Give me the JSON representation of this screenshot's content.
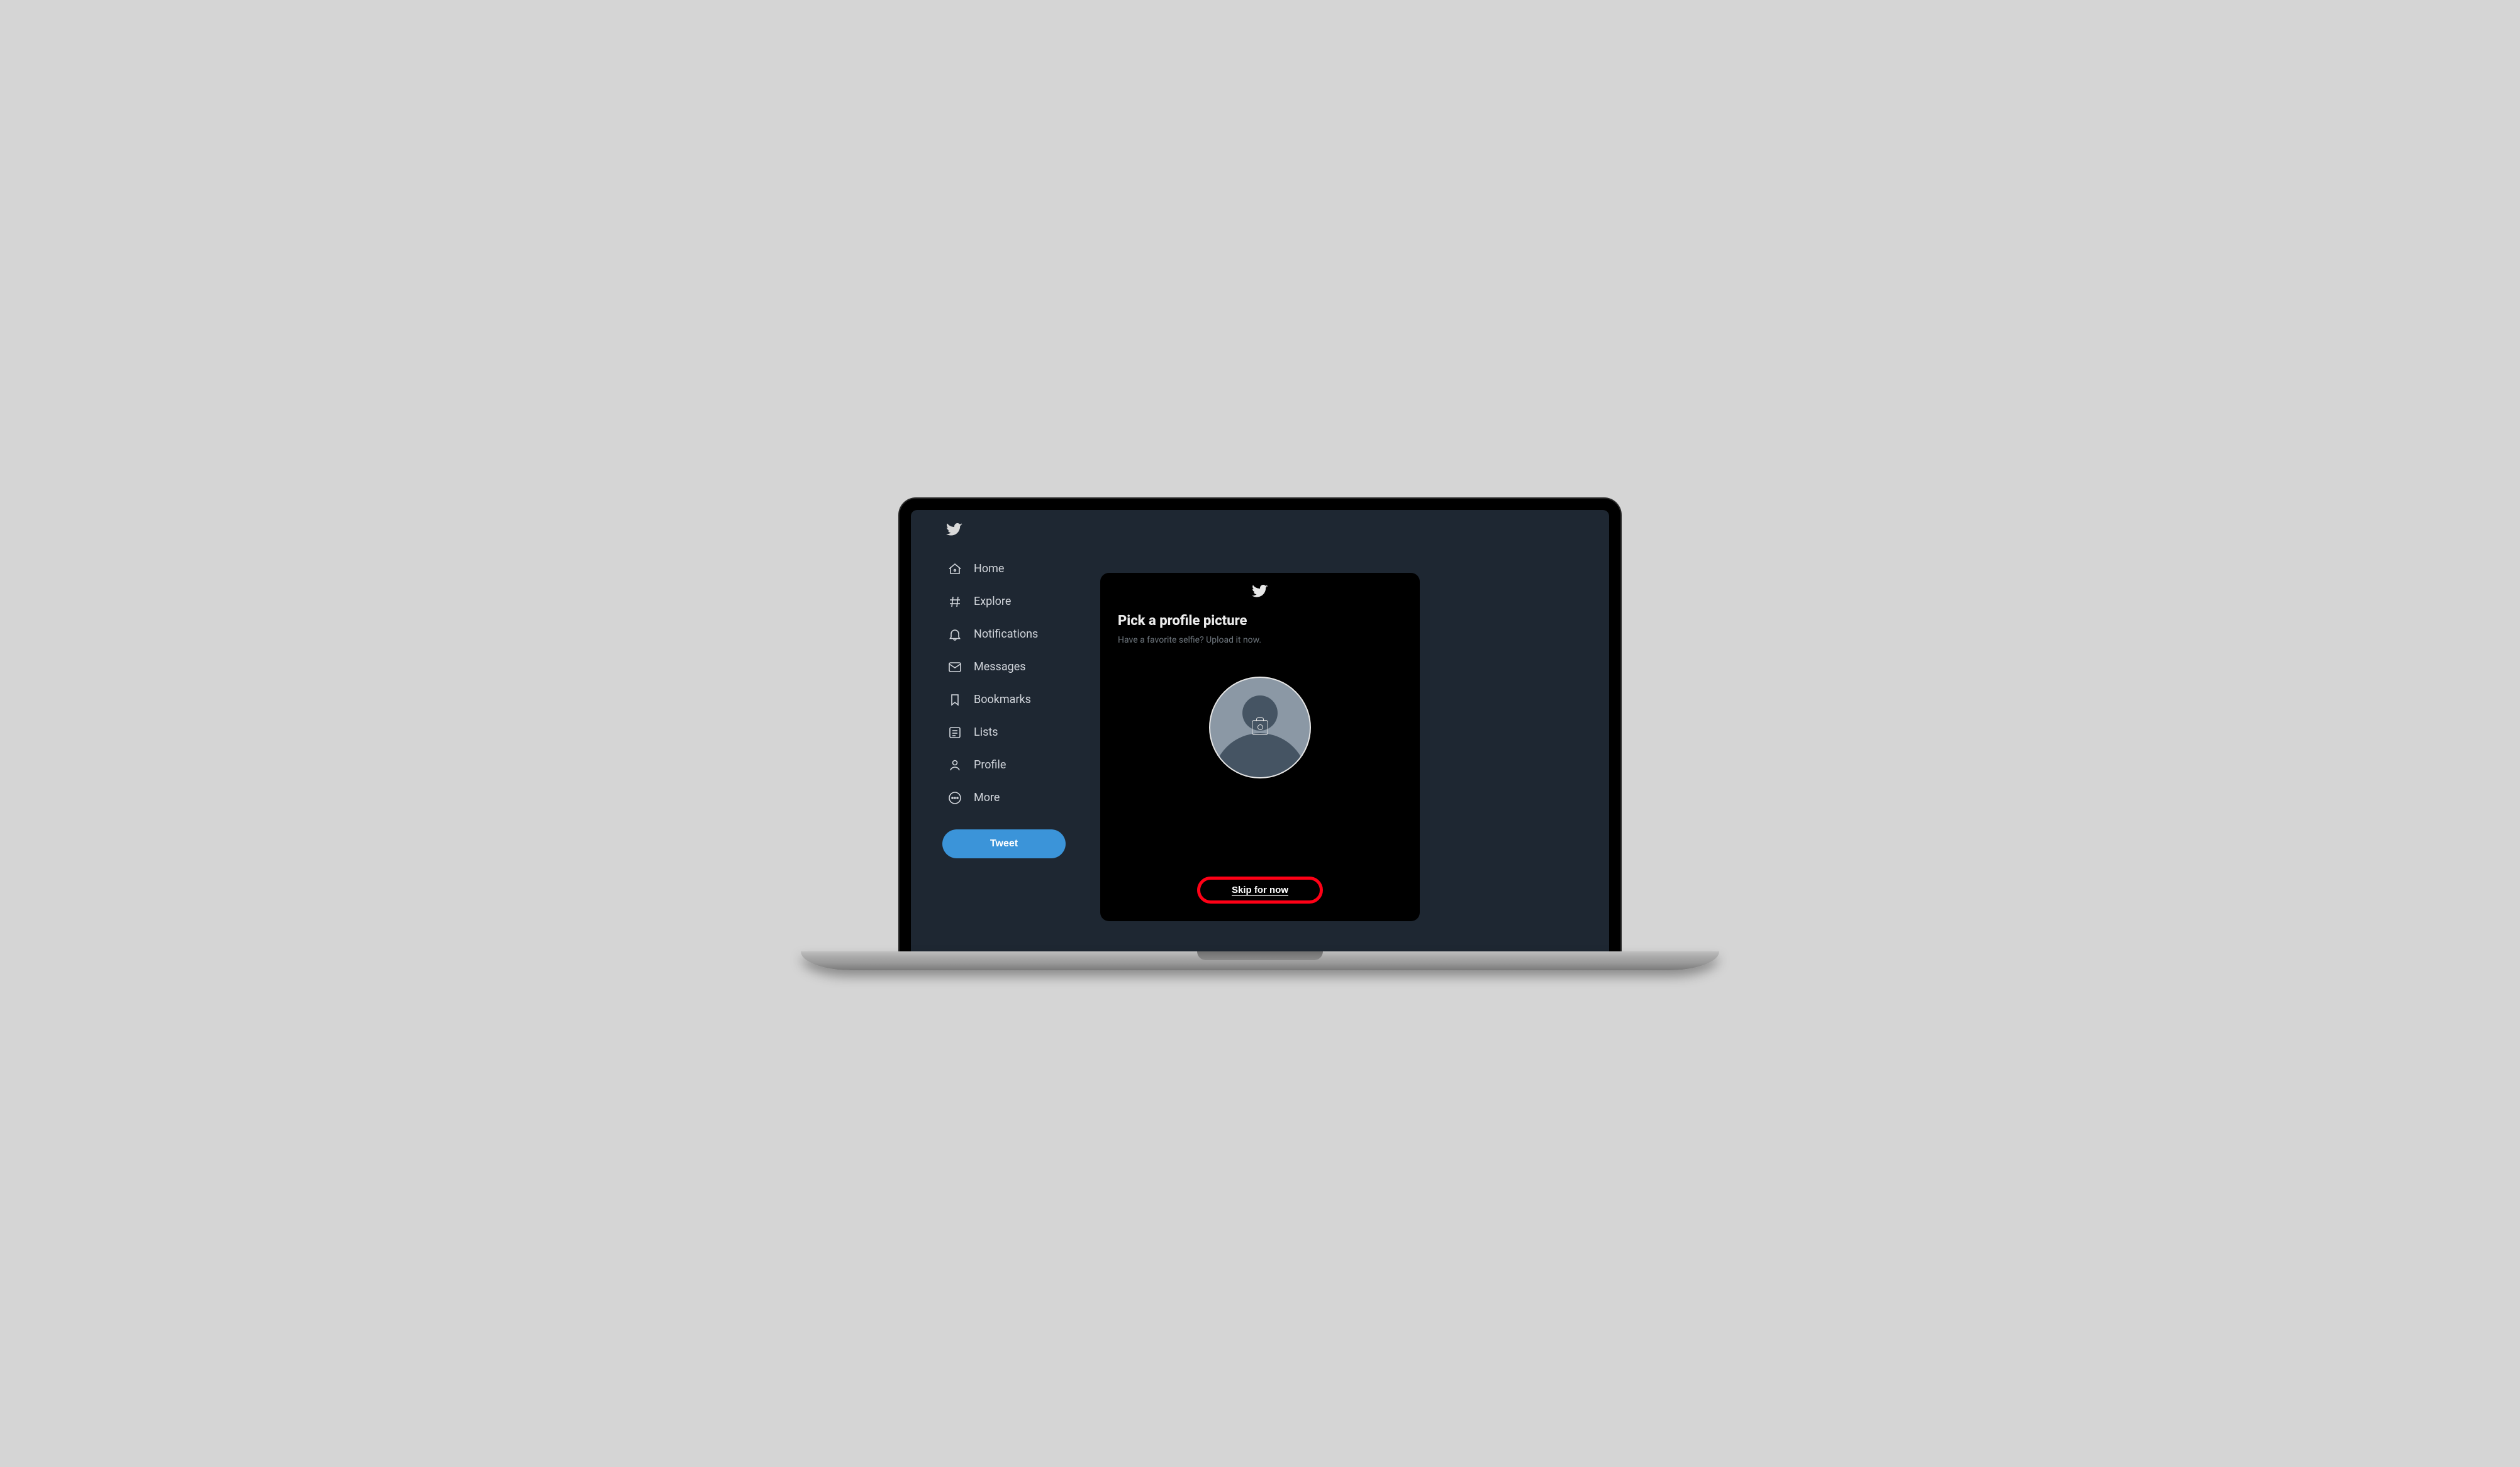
{
  "sidebar": {
    "items": [
      {
        "label": "Home"
      },
      {
        "label": "Explore"
      },
      {
        "label": "Notifications"
      },
      {
        "label": "Messages"
      },
      {
        "label": "Bookmarks"
      },
      {
        "label": "Lists"
      },
      {
        "label": "Profile"
      },
      {
        "label": "More"
      }
    ],
    "tweet_label": "Tweet"
  },
  "modal": {
    "title": "Pick a profile picture",
    "subtitle": "Have a favorite selfie? Upload it now.",
    "skip_label": "Skip for now"
  },
  "colors": {
    "app_bg": "#1e2732",
    "accent": "#3b94d9",
    "highlight_ring": "#ff0016"
  }
}
